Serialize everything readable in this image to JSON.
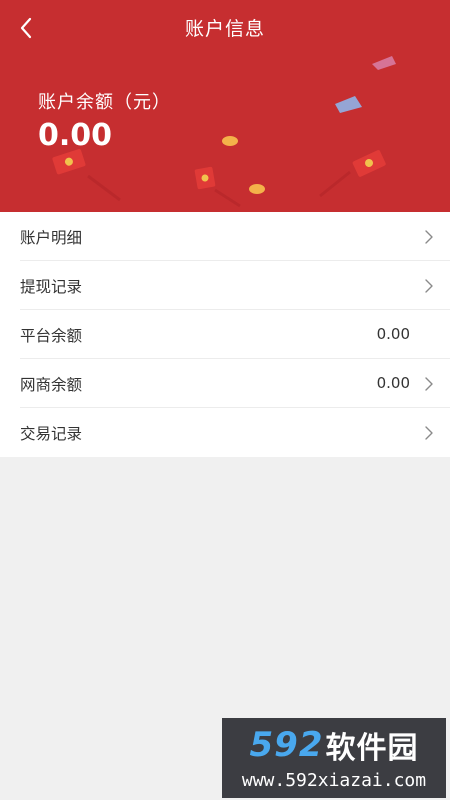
{
  "nav": {
    "title": "账户信息",
    "back_icon": "chevron-left-icon"
  },
  "balance": {
    "label": "账户余额（元）",
    "amount": "0.00"
  },
  "list": {
    "items": [
      {
        "label": "账户明细",
        "value": ""
      },
      {
        "label": "提现记录",
        "value": ""
      },
      {
        "label": "平台余额",
        "value": "0.00"
      },
      {
        "label": "网商余额",
        "value": "0.00"
      },
      {
        "label": "交易记录",
        "value": ""
      }
    ]
  },
  "watermark": {
    "number": "592",
    "name": "软件园",
    "url": "www.592xiazai.com"
  },
  "colors": {
    "header_bg": "#c62e30",
    "page_bg": "#f0f0f0",
    "accent_blue": "#49a8ee"
  }
}
